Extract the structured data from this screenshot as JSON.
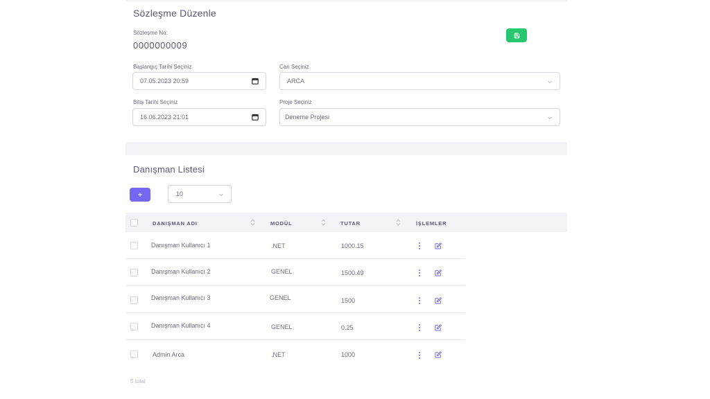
{
  "form": {
    "title": "Sözleşme Düzenle",
    "contract_no_label": "Sözleşme No:",
    "contract_no": "0000000009",
    "start_date_label": "Başlangıç Tarihi Seçiniz",
    "start_date": "07.05.2023 20:59",
    "end_date_label": "Bitiş Tarihi Seçiniz",
    "end_date": "16.06.2023 21:01",
    "client_label": "Cari Seçiniz",
    "client": "ARCA",
    "project_label": "Proje Seçiniz",
    "project": "Deneme Projesi",
    "save_icon": "save-icon",
    "colors": {
      "save": "#28c76f",
      "primary": "#7367f0"
    }
  },
  "list": {
    "title": "Danışman Listesi",
    "add_label": "+",
    "page_size": "10",
    "columns": [
      "DANIŞMAN ADI",
      "MODÜL",
      "TUTAR",
      "İŞLEMLER"
    ],
    "rows": [
      {
        "name": "Danışman Kullanıcı 1",
        "module": ".NET",
        "amount": "1000.15"
      },
      {
        "name": "Danışman Kullanıcı 2",
        "module": "GENEL",
        "amount": "1500.49"
      },
      {
        "name": "Danışman Kullanıcı 3",
        "module": "GENEL",
        "amount": "1500"
      },
      {
        "name": "Danışman Kullanıcı 4",
        "module": "GENEL",
        "amount": "0.25"
      },
      {
        "name": "Admin Arca",
        "module": ".NET",
        "amount": "1000"
      }
    ],
    "total": "5 total"
  }
}
